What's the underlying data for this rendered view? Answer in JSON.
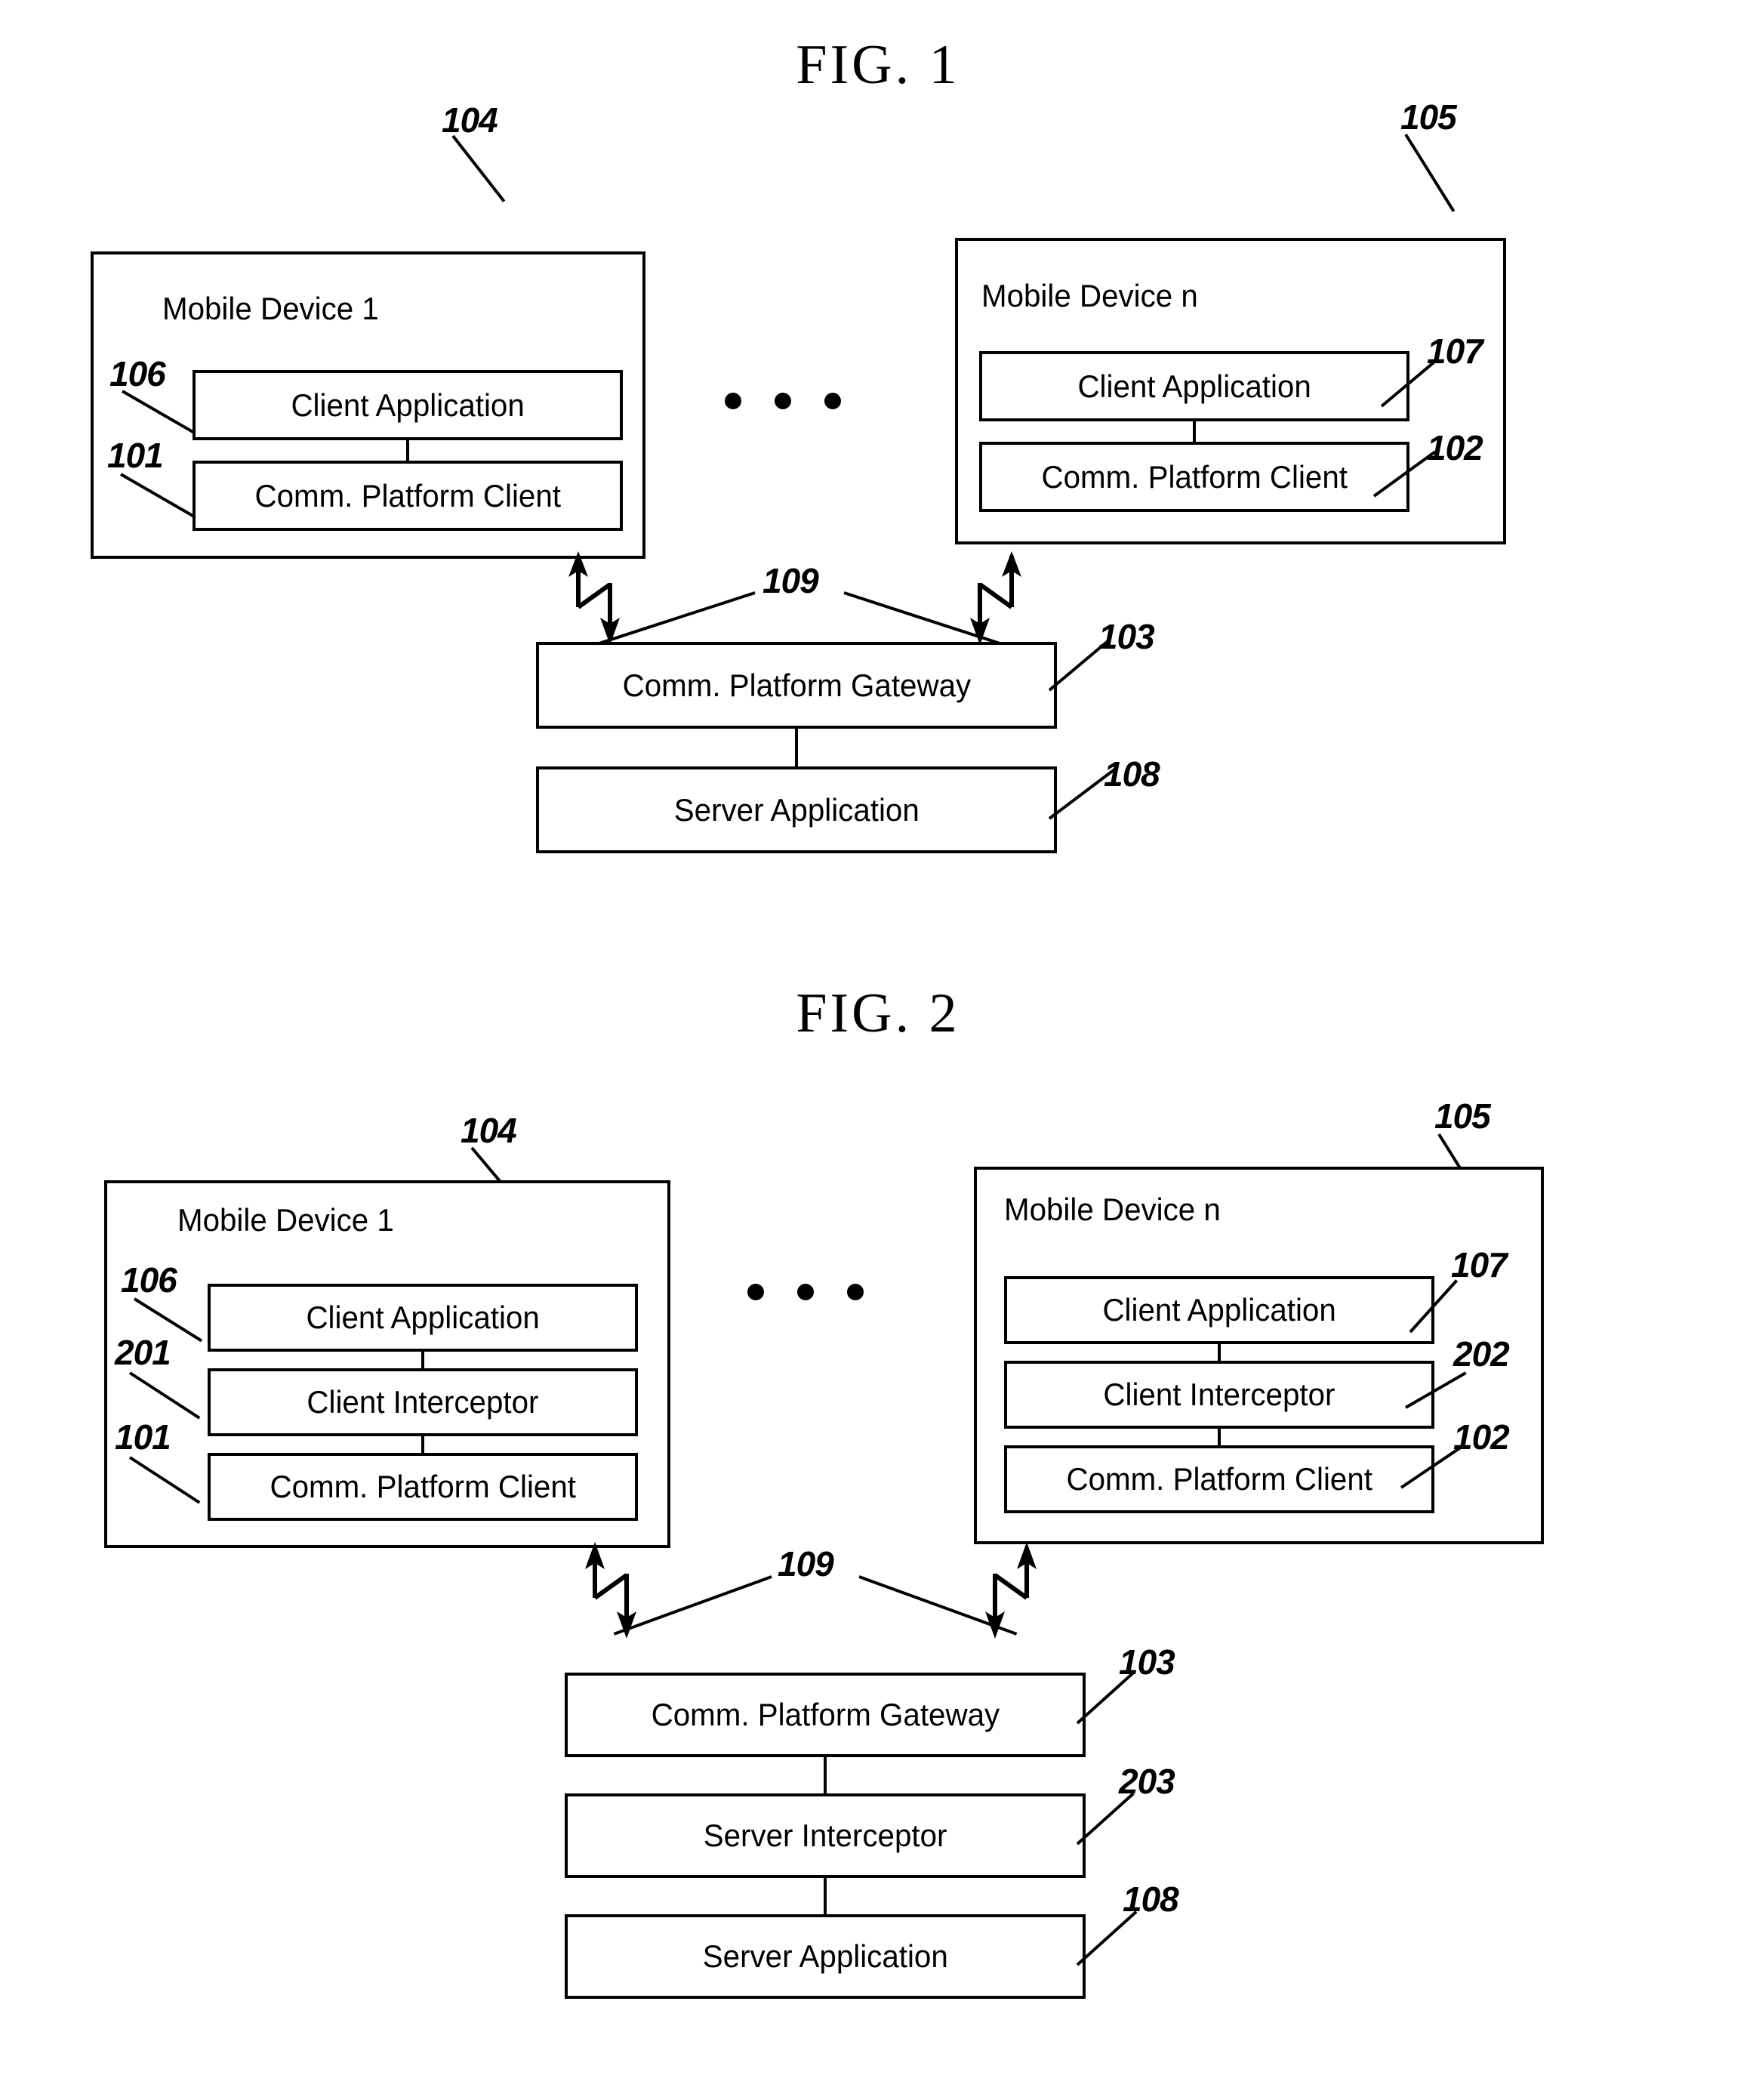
{
  "figures": [
    {
      "id": "fig1",
      "title": "FIG. 1",
      "left_device": {
        "title": "Mobile Device 1",
        "ref": "104",
        "components": [
          {
            "label": "Client Application",
            "ref": "106"
          },
          {
            "label": "Comm. Platform Client",
            "ref": "101"
          }
        ]
      },
      "right_device": {
        "title": "Mobile Device n",
        "ref": "105",
        "components": [
          {
            "label": "Client Application",
            "ref": "107"
          },
          {
            "label": "Comm. Platform Client",
            "ref": "102"
          }
        ]
      },
      "ellipsis": "• • •",
      "link_ref": "109",
      "server_stack": [
        {
          "label": "Comm. Platform Gateway",
          "ref": "103"
        },
        {
          "label": "Server Application",
          "ref": "108"
        }
      ]
    },
    {
      "id": "fig2",
      "title": "FIG. 2",
      "left_device": {
        "title": "Mobile Device 1",
        "ref": "104",
        "components": [
          {
            "label": "Client Application",
            "ref": "106"
          },
          {
            "label": "Client Interceptor",
            "ref": "201"
          },
          {
            "label": "Comm. Platform Client",
            "ref": "101"
          }
        ]
      },
      "right_device": {
        "title": "Mobile Device n",
        "ref": "105",
        "components": [
          {
            "label": "Client Application",
            "ref": "107"
          },
          {
            "label": "Client Interceptor",
            "ref": "202"
          },
          {
            "label": "Comm. Platform Client",
            "ref": "102"
          }
        ]
      },
      "ellipsis": "• • •",
      "link_ref": "109",
      "server_stack": [
        {
          "label": "Comm. Platform Gateway",
          "ref": "103"
        },
        {
          "label": "Server Interceptor",
          "ref": "203"
        },
        {
          "label": "Server Application",
          "ref": "108"
        }
      ]
    }
  ],
  "colors": {
    "ink": "#000000",
    "paper": "#ffffff"
  }
}
